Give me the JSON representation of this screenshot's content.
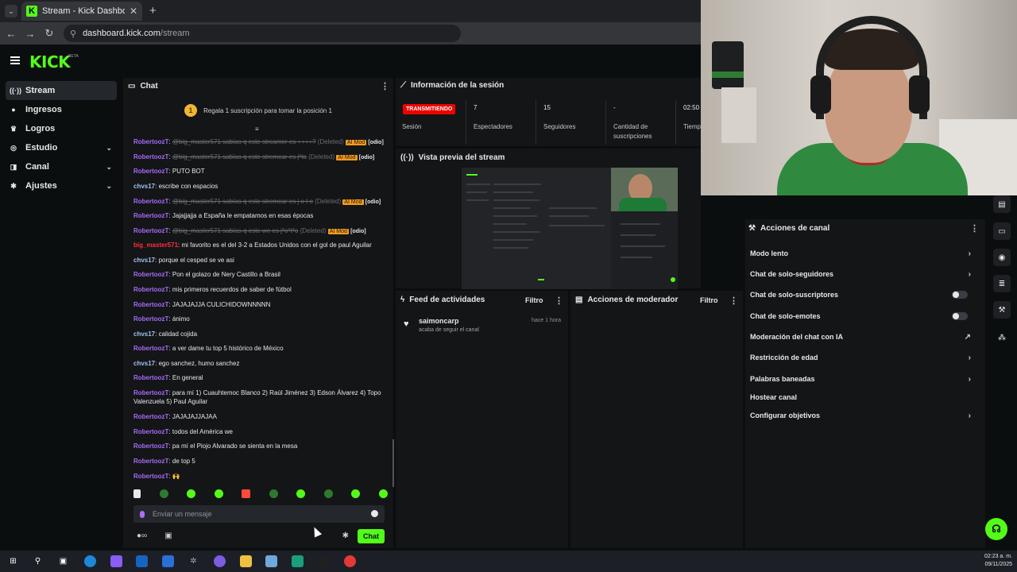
{
  "browser": {
    "tab_title": "Stream - Kick Dashboard",
    "url_host": "dashboard.kick.com",
    "url_path": "/stream"
  },
  "brand": {
    "logo": "KICK",
    "beta": "BETA",
    "accent": "#53fc18"
  },
  "sidebar": {
    "items": [
      {
        "label": "Stream",
        "icon": "broadcast-icon",
        "active": true
      },
      {
        "label": "Ingresos",
        "icon": "coin-icon"
      },
      {
        "label": "Logros",
        "icon": "trophy-icon"
      },
      {
        "label": "Estudio",
        "icon": "studio-icon",
        "expandable": true
      },
      {
        "label": "Canal",
        "icon": "channel-icon",
        "expandable": true
      },
      {
        "label": "Ajustes",
        "icon": "gear-icon",
        "expandable": true
      }
    ]
  },
  "chat": {
    "title": "Chat",
    "pinned_rank": "1",
    "pinned_text": "Regala 1 suscripción para tomar la posición 1",
    "messages": [
      {
        "user": "RobertoozT",
        "color": "purple",
        "text": "@big_master571 sabías q este streamer es ++++?",
        "deleted": true,
        "note": "(Deleted)",
        "badge": "AI Mod",
        "tag": "[odio]"
      },
      {
        "user": "RobertoozT",
        "color": "purple",
        "text": "@big_master571 sabías q este stremear es j*to",
        "deleted": true,
        "note": "(Deleted)",
        "badge": "AI Mod",
        "tag": "[odio]"
      },
      {
        "user": "RobertoozT",
        "color": "purple",
        "text": "PUTO BOT"
      },
      {
        "user": "chvs17",
        "color": "blue",
        "text": "escribe con espacios"
      },
      {
        "user": "RobertoozT",
        "color": "purple",
        "text": "@big_master571 sabías q este stremear es j o t o",
        "deleted": true,
        "note": "(Deleted)",
        "badge": "AI Mod",
        "tag": "[odio]"
      },
      {
        "user": "RobertoozT",
        "color": "purple",
        "text": "Jajajjajja a España le empatamos en esas épocas"
      },
      {
        "user": "RobertoozT",
        "color": "purple",
        "text": "@big_master571 sabías q este we es j*o*t*o",
        "deleted": true,
        "note": "(Deleted)",
        "badge": "AI Mod",
        "tag": "[odio]"
      },
      {
        "user": "big_master571",
        "color": "red",
        "text": "mi favorito es el del 3-2 a Estados Unidos con el gol de paul Aguilar"
      },
      {
        "user": "chvs17",
        "color": "blue",
        "text": "porque el cesped se ve asi"
      },
      {
        "user": "RobertoozT",
        "color": "purple",
        "text": "Pon el golazo de Nery Castillo a Brasil"
      },
      {
        "user": "RobertoozT",
        "color": "purple",
        "text": "mis primeros recuerdos de saber de fútbol"
      },
      {
        "user": "RobertoozT",
        "color": "purple",
        "text": "JAJAJAJJA CULICHIDOWNNNNN"
      },
      {
        "user": "RobertoozT",
        "color": "purple",
        "text": "ánimo"
      },
      {
        "user": "chvs17",
        "color": "blue",
        "text": "calidad cojida"
      },
      {
        "user": "RobertoozT",
        "color": "purple",
        "text": "a ver dame tu top 5 histórico de México"
      },
      {
        "user": "chvs17",
        "color": "blue",
        "text": "ego sanchez, humo sanchez"
      },
      {
        "user": "RobertoozT",
        "color": "purple",
        "text": "En general"
      },
      {
        "user": "RobertoozT",
        "color": "purple",
        "text": "para mí 1) Cuauhtemoc Blanco 2) Raúl Jiménez 3) Edson Álvarez 4) Topo Valenzuela 5) Paul Aguilar"
      },
      {
        "user": "RobertoozT",
        "color": "purple",
        "text": "JAJAJAJJAJAA"
      },
      {
        "user": "RobertoozT",
        "color": "purple",
        "text": "todos del América we"
      },
      {
        "user": "RobertoozT",
        "color": "purple",
        "text": "pa mí el Piojo Alvarado se sienta en la mesa"
      },
      {
        "user": "RobertoozT",
        "color": "purple",
        "text": "de top 5"
      },
      {
        "user": "RobertoozT",
        "color": "purple",
        "text": "🙌"
      }
    ],
    "input_placeholder": "Enviar un mensaje",
    "send_label": "Chat",
    "infinity": "∞"
  },
  "session": {
    "title": "Información de la sesión",
    "status": "TRANSMITIENDO",
    "stats": [
      {
        "value": "",
        "label": "Sesión"
      },
      {
        "value": "7",
        "label": "Espectadores"
      },
      {
        "value": "15",
        "label": "Seguidores"
      },
      {
        "value": "-",
        "label": "Cantidad de suscripciones"
      },
      {
        "value": "02:50",
        "label": "Tiempo"
      }
    ]
  },
  "preview": {
    "title": "Vista previa del stream"
  },
  "feed": {
    "title": "Feed de actividades",
    "filter": "Filtro",
    "items": [
      {
        "user": "saimoncarp",
        "action": "acaba de seguir el canal",
        "time": "hace 1 hora"
      }
    ]
  },
  "moderator": {
    "title": "Acciones de moderador",
    "filter": "Filtro"
  },
  "channel_actions": {
    "title": "Acciones de canal",
    "items": [
      {
        "label": "Modo lento",
        "control": "chevron"
      },
      {
        "label": "Chat de solo-seguidores",
        "control": "chevron"
      },
      {
        "label": "Chat de solo-suscriptores",
        "control": "toggle"
      },
      {
        "label": "Chat de solo-emotes",
        "control": "toggle"
      },
      {
        "label": "Moderación del chat con IA",
        "control": "external"
      },
      {
        "label": "Restricción de edad",
        "control": "chevron"
      },
      {
        "label": "Palabras baneadas",
        "control": "chevron"
      },
      {
        "label": "Hostear canal",
        "control": "none"
      },
      {
        "label": "Configurar objetivos",
        "control": "chevron"
      }
    ]
  },
  "taskbar": {
    "time": "02:23 a. m.",
    "date": "09/11/2025"
  }
}
